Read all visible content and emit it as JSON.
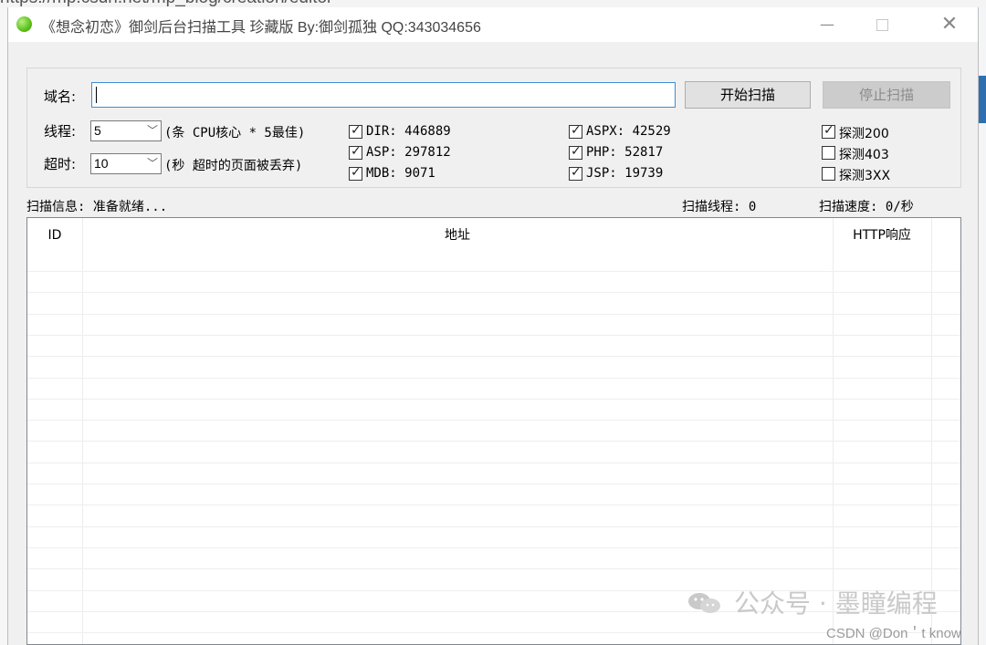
{
  "background": {
    "url_fragment": "https://mp.csdn.net/mp_blog/creation/editor"
  },
  "window": {
    "title": "《想念初恋》御剑后台扫描工具 珍藏版 By:御剑孤独 QQ:343034656",
    "icon": "green-orb-icon",
    "controls": {
      "minimize": "—",
      "close": "✕"
    }
  },
  "form": {
    "domain_label": "域名:",
    "domain_value": "",
    "start_button": "开始扫描",
    "stop_button": "停止扫描",
    "threads_label": "线程:",
    "threads_value": "5",
    "threads_hint": "(条 CPU核心 * 5最佳)",
    "timeout_label": "超时:",
    "timeout_value": "10",
    "timeout_hint": "(秒 超时的页面被丢弃)"
  },
  "dictionaries": [
    {
      "label": "DIR: 446889",
      "checked": true
    },
    {
      "label": "ASP: 297812",
      "checked": true
    },
    {
      "label": "MDB: 9071",
      "checked": true
    },
    {
      "label": "ASPX: 42529",
      "checked": true
    },
    {
      "label": "PHP: 52817",
      "checked": true
    },
    {
      "label": "JSP: 19739",
      "checked": true
    }
  ],
  "probes": [
    {
      "label": "探测200",
      "checked": true
    },
    {
      "label": "探测403",
      "checked": false
    },
    {
      "label": "探测3XX",
      "checked": false
    }
  ],
  "status": {
    "info": "扫描信息: 准备就绪...",
    "threads": "扫描线程: 0",
    "speed": "扫描速度: 0/秒"
  },
  "table": {
    "columns": [
      "ID",
      "地址",
      "HTTP响应"
    ],
    "rows": []
  },
  "watermark": {
    "text": "公众号 · 墨瞳编程",
    "csdn": "CSDN @Don＇t know"
  },
  "colors": {
    "accent_border": "#3c8fd8",
    "window_bg": "#f0f0f0",
    "disabled_text": "#8a8a8a"
  }
}
